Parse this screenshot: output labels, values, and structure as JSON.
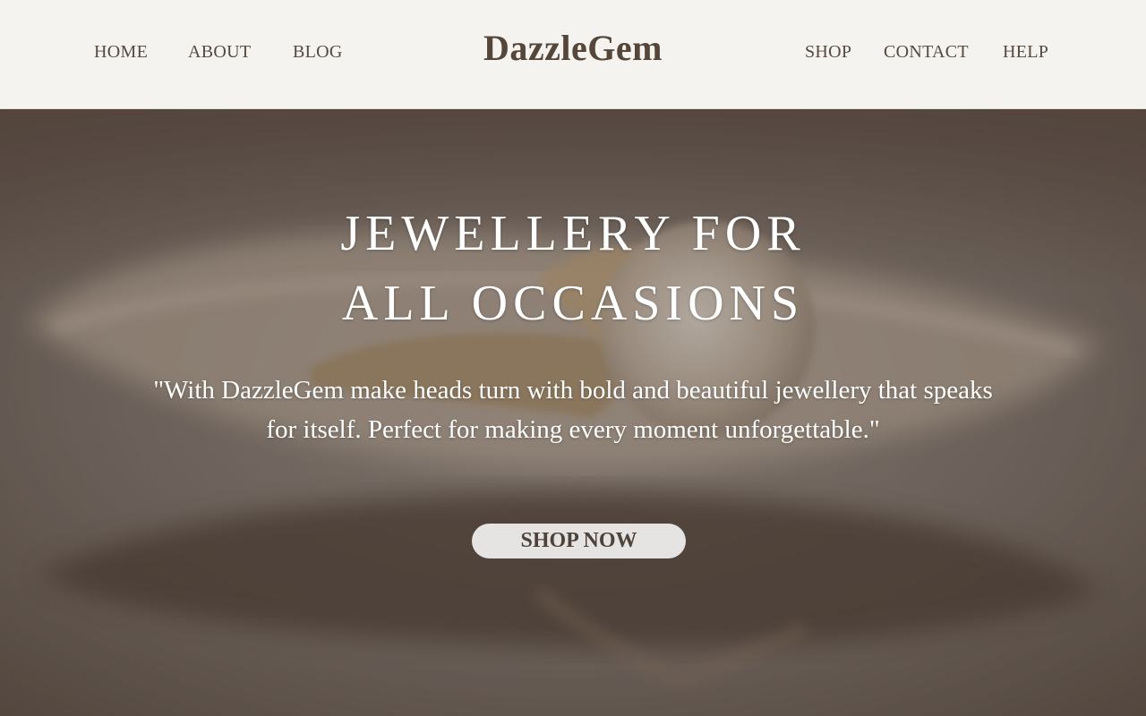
{
  "brand": {
    "name": "DazzleGem"
  },
  "nav": {
    "left": [
      "HOME",
      "ABOUT",
      "BLOG"
    ],
    "right": [
      "SHOP",
      "CONTACT",
      "HELP"
    ]
  },
  "hero": {
    "title_line1": "JEWELLERY FOR",
    "title_line2": "ALL OCCASIONS",
    "quote": "\"With DazzleGem make heads turn with bold and beautiful jewellery that speaks for itself. Perfect for making every moment unforgettable.\"",
    "cta_label": "SHOP NOW",
    "background_image": "pearl-ring-on-shell-photo"
  },
  "colors": {
    "header_bg": "#f4f3ef",
    "brand_text": "#55463a",
    "nav_text": "#56493f",
    "hero_overlay": "#5f5650",
    "cta_bg": "#e6e4e2",
    "cta_text": "#4f4339"
  }
}
